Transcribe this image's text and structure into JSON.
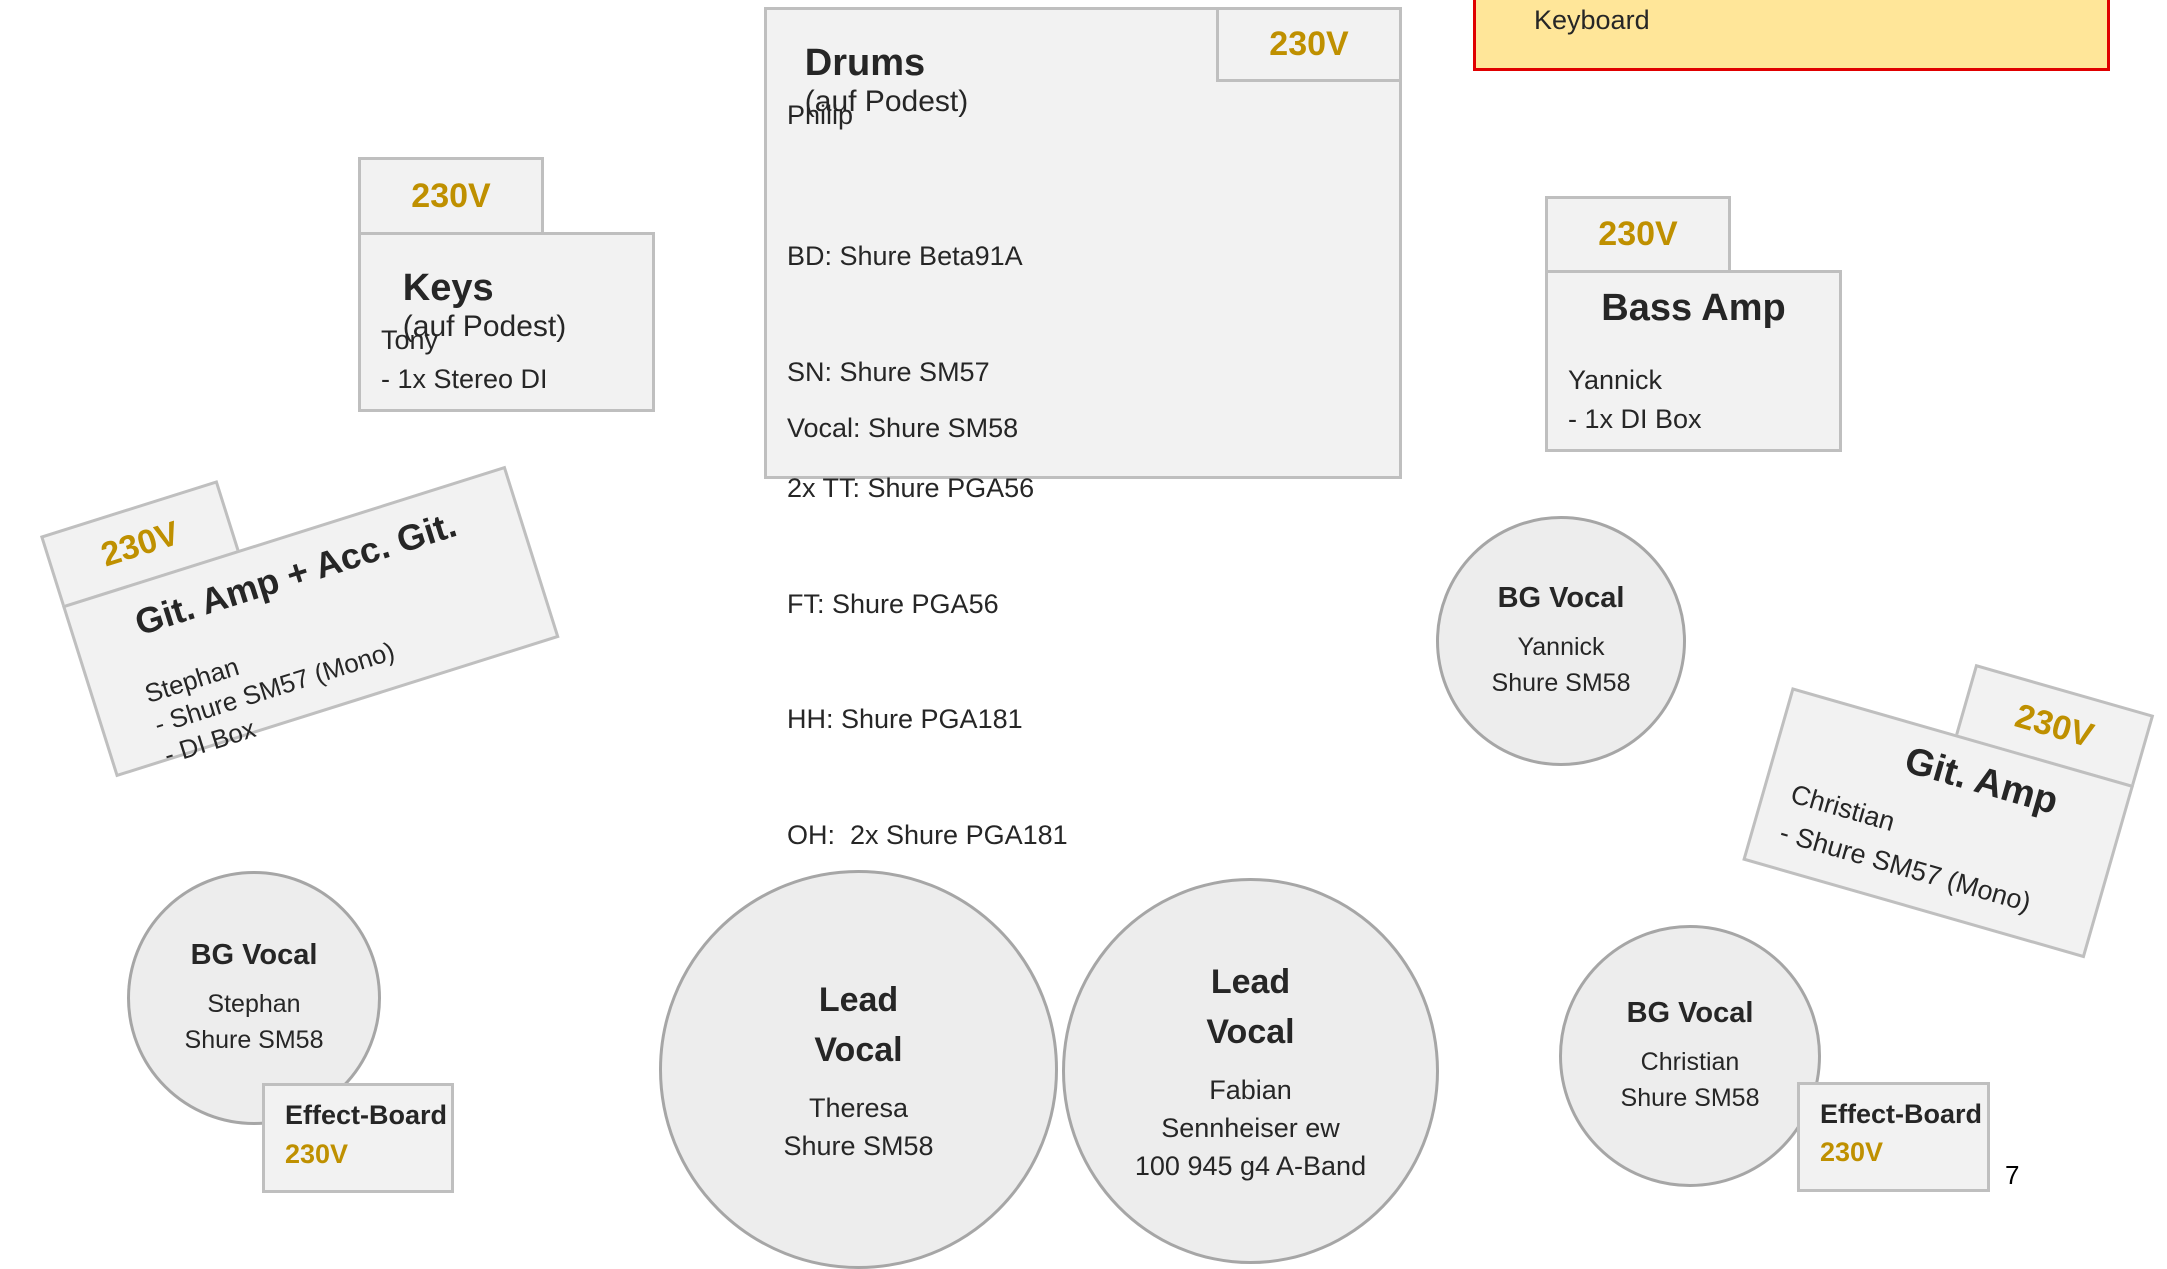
{
  "keyboard_box": {
    "label": "Keyboard"
  },
  "drums": {
    "title": "Drums",
    "subtitle": "(auf Podest)",
    "power": "230V",
    "player": "Philip",
    "mics": [
      "BD: Shure Beta91A",
      "SN: Shure SM57",
      "2x TT: Shure PGA56",
      "FT: Shure PGA56",
      "HH: Shure PGA181",
      "OH:  2x Shure PGA181"
    ],
    "vocal": "Vocal: Shure SM58"
  },
  "keys": {
    "title": "Keys",
    "subtitle": "(auf Podest)",
    "power": "230V",
    "player": "Tony",
    "detail": "- 1x Stereo DI"
  },
  "bass_amp": {
    "title": "Bass Amp",
    "power": "230V",
    "player": "Yannick",
    "detail": "- 1x DI Box"
  },
  "git_amp_acc": {
    "title": "Git. Amp + Acc. Git.",
    "power": "230V",
    "player": "Stephan",
    "detail1": "- Shure SM57 (Mono)",
    "detail2": "- DI Box"
  },
  "git_amp": {
    "title": "Git. Amp",
    "power": "230V",
    "player": "Christian",
    "detail": "- Shure SM57 (Mono)"
  },
  "bg_vocal_yannick": {
    "title": "BG Vocal",
    "name": "Yannick",
    "mic": "Shure SM58"
  },
  "bg_vocal_stephan": {
    "title": "BG Vocal",
    "name": "Stephan",
    "mic": "Shure SM58"
  },
  "bg_vocal_christian": {
    "title": "BG Vocal",
    "name": "Christian",
    "mic": "Shure SM58"
  },
  "lead_vocal_theresa": {
    "title1": "Lead",
    "title2": "Vocal",
    "name": "Theresa",
    "mic": "Shure SM58"
  },
  "lead_vocal_fabian": {
    "title1": "Lead",
    "title2": "Vocal",
    "name": "Fabian",
    "mic1": "Sennheiser ew",
    "mic2": "100 945 g4 A-Band"
  },
  "effect_board_left": {
    "title": "Effect-Board",
    "power": "230V"
  },
  "effect_board_right": {
    "title": "Effect-Board",
    "power": "230V"
  },
  "page_number": "7",
  "colors": {
    "power_text": "#bf9000",
    "box_fill": "#f2f2f2",
    "box_border": "#bfbfbf",
    "keyboard_fill": "#ffe699",
    "keyboard_border": "#e00000"
  }
}
